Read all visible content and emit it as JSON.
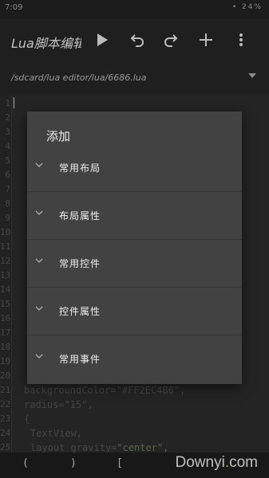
{
  "status_bar": {
    "time": "7:09",
    "icons_text": "• 24%"
  },
  "toolbar": {
    "title": "Lua脚本编辑器"
  },
  "path_bar": {
    "path": "/sdcard/lua editor/lua/6686.lua"
  },
  "editor": {
    "line_numbers": [
      "1",
      "2",
      "3",
      "4",
      "5",
      "6",
      "7",
      "8",
      "9",
      "10",
      "11",
      "12",
      "13",
      "14",
      "15",
      "16",
      "17",
      "18",
      "19",
      "20",
      "21",
      "22",
      "23",
      "24",
      "25"
    ],
    "visible_code": {
      "l21": "backgroundColor=\"#FF2EC4B6\",",
      "l22": "radius=\"15\",",
      "l23": "{",
      "l24": "TextView,",
      "l25_prefix": "layout_gravity=",
      "l25_value": "\"center\","
    }
  },
  "dialog": {
    "title": "添加",
    "items": [
      {
        "label": "常用布局"
      },
      {
        "label": "布局属性"
      },
      {
        "label": "常用控件"
      },
      {
        "label": "控件属性"
      },
      {
        "label": "常用事件"
      }
    ]
  },
  "symbol_bar": {
    "symbols": [
      "(",
      ")",
      "["
    ]
  },
  "watermark": {
    "prefix": "Downyi",
    "dot": ".",
    "suffix": "com"
  }
}
